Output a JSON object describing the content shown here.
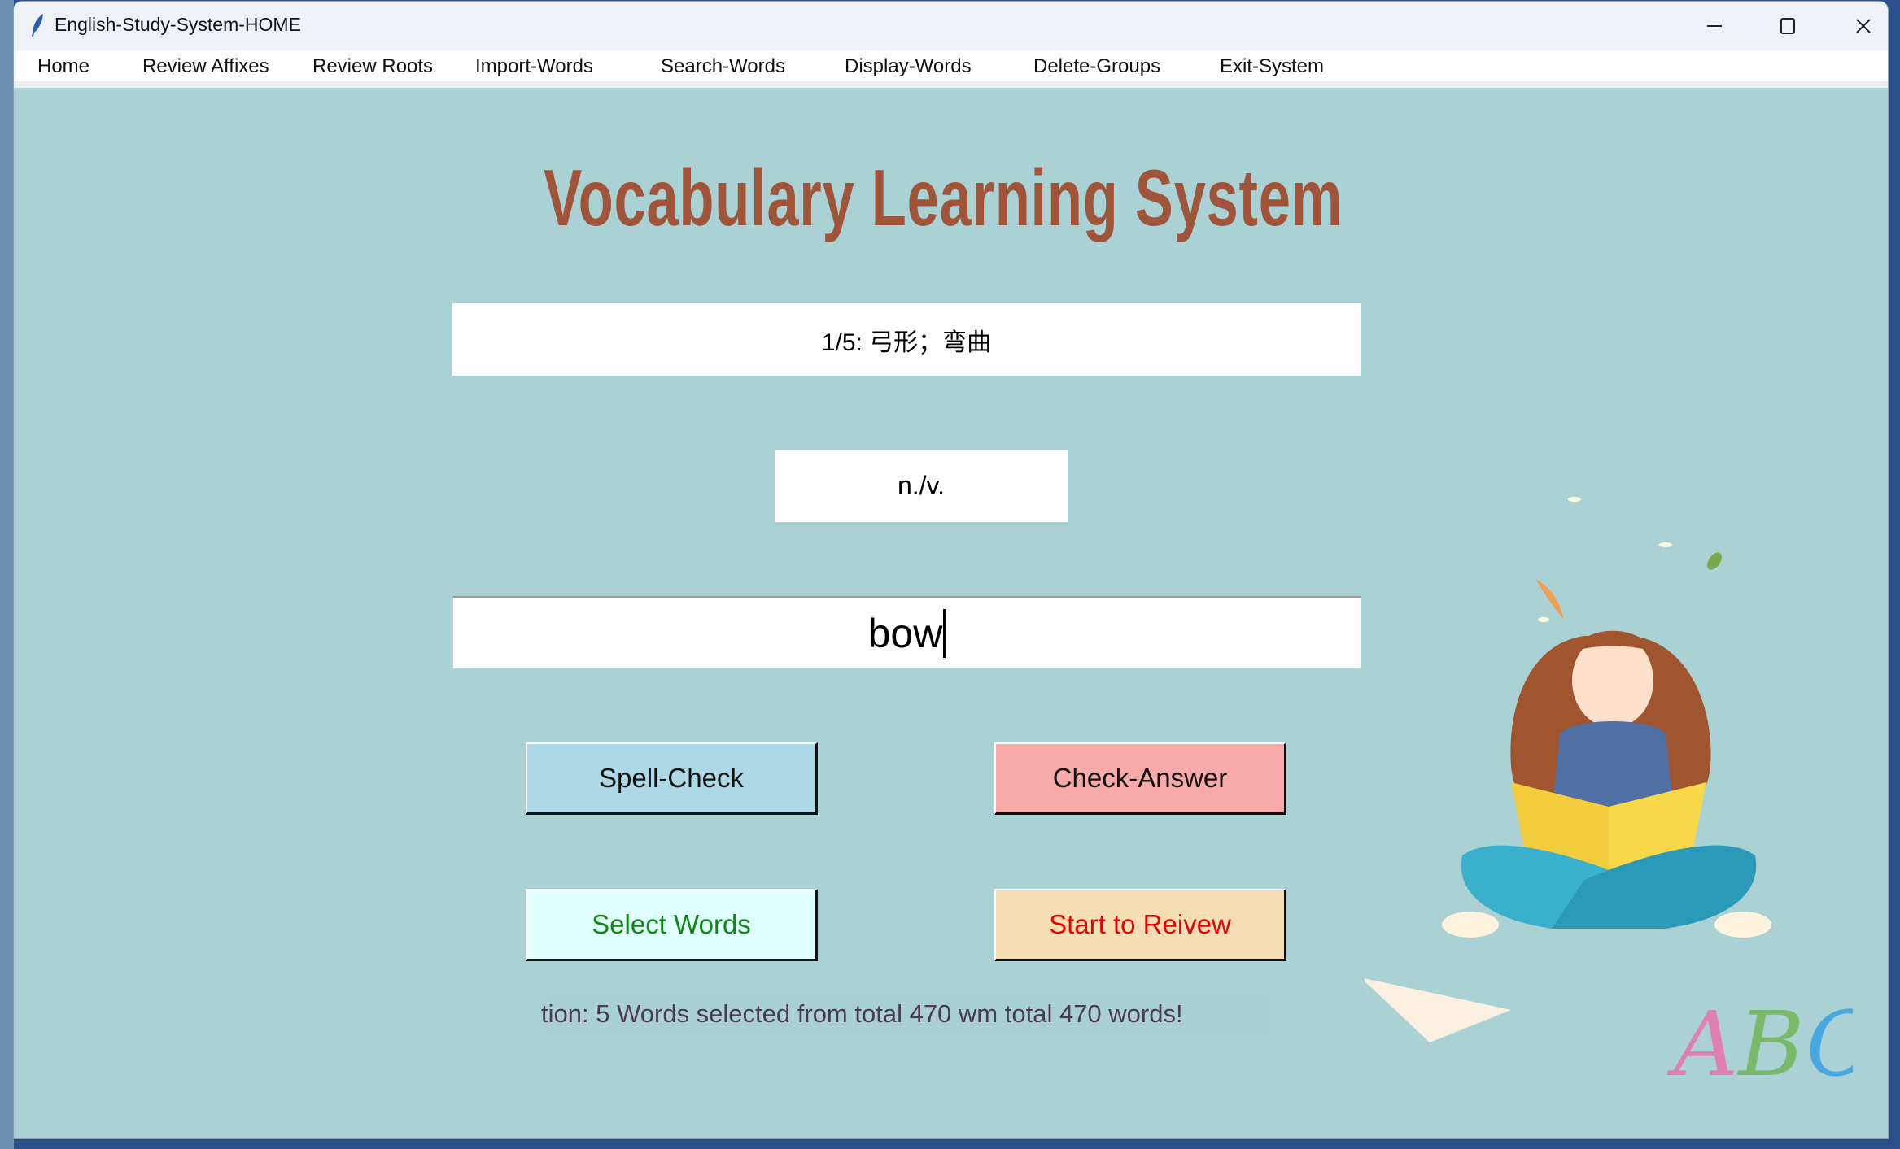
{
  "window": {
    "title": "English-Study-System-HOME",
    "controls": {
      "minimize": "–",
      "maximize": "☐",
      "close": "✕"
    }
  },
  "menu": {
    "items": [
      "Home",
      "Review Affixes",
      "Review Roots",
      "Import-Words",
      "Search-Words",
      "Display-Words",
      "Delete-Groups",
      "Exit-System"
    ]
  },
  "main": {
    "title": "Vocabulary Learning System",
    "meaning": "1/5: 弓形；弯曲",
    "part_of_speech": "n./v.",
    "answer_input": "bow",
    "buttons": {
      "spell_check": "Spell-Check",
      "check_answer": "Check-Answer",
      "select_words": "Select Words",
      "start_review": "Start to Reivew"
    },
    "status": "tion: 5 Words selected from total 470 wm total 470 words!",
    "illustration_text": "ABC"
  },
  "colors": {
    "background": "#aad2d5",
    "title": "#a0553a",
    "spell_check_bg": "#add8e6",
    "check_answer_bg": "#f8a9a9",
    "select_words_bg": "#e0ffff",
    "select_words_fg": "#118811",
    "start_review_bg": "#f5deb3",
    "start_review_fg": "#ee0000"
  }
}
